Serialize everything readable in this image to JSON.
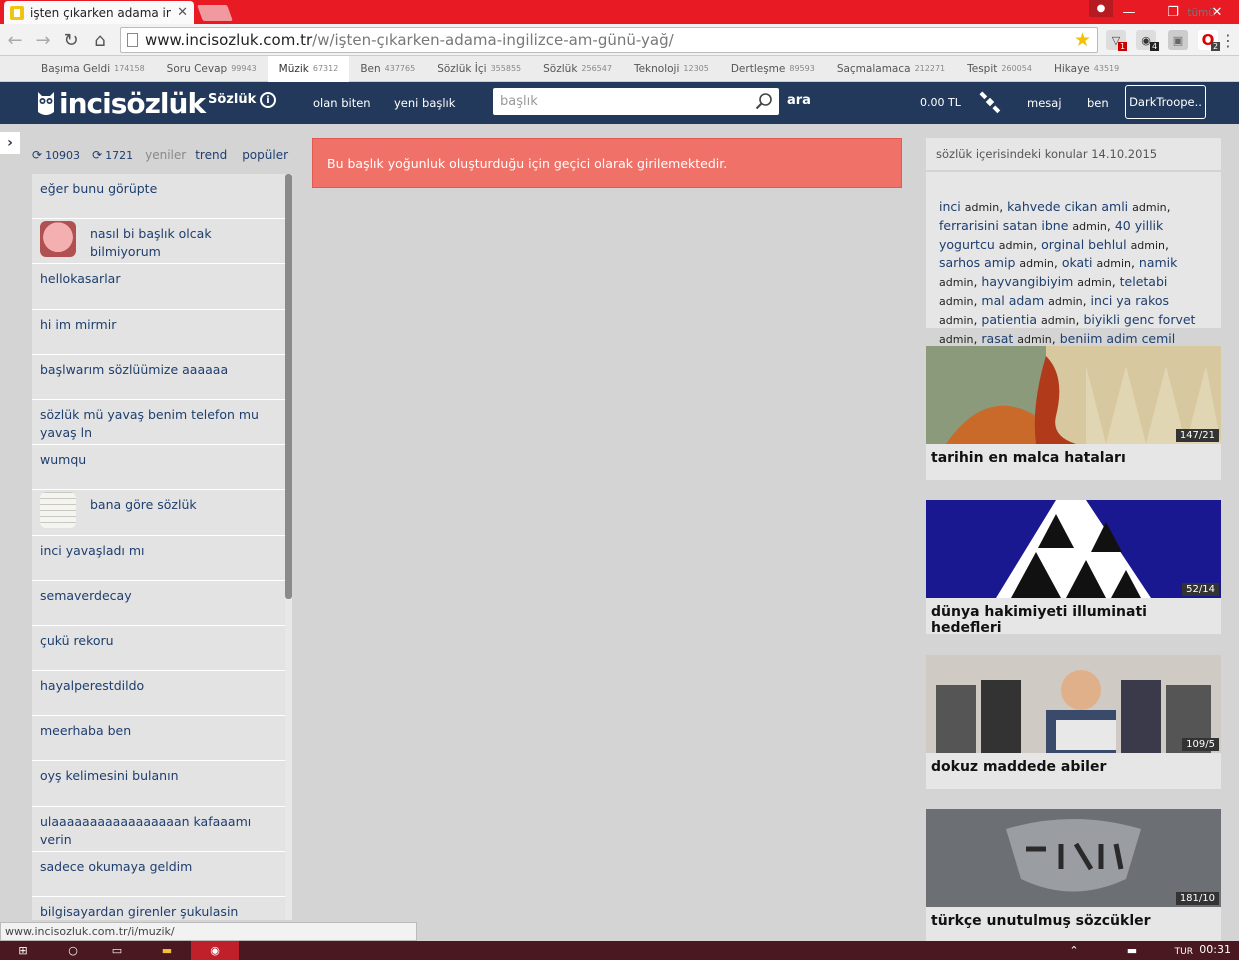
{
  "browser": {
    "tab_title": "işten çıkarken adama ingil",
    "close": "✕",
    "url_host": "www.incisozluk.com.tr",
    "url_path": "/w/işten-çıkarken-adama-ingilizce-am-günü-yağ/",
    "ext_badges": [
      "1",
      "4",
      "2"
    ],
    "window_controls": [
      "—",
      "❐",
      "✕"
    ]
  },
  "categories": [
    {
      "name": "Başıma Geldi",
      "count": "174158"
    },
    {
      "name": "Soru Cevap",
      "count": "99943"
    },
    {
      "name": "Müzik",
      "count": "67312"
    },
    {
      "name": "Ben",
      "count": "437765"
    },
    {
      "name": "Sözlük İçi",
      "count": "355855"
    },
    {
      "name": "Sözlük",
      "count": "256547"
    },
    {
      "name": "Teknoloji",
      "count": "12305"
    },
    {
      "name": "Dertleşme",
      "count": "89593"
    },
    {
      "name": "Saçmalamaca",
      "count": "212271"
    },
    {
      "name": "Tespit",
      "count": "260054"
    },
    {
      "name": "Hikaye",
      "count": "43519"
    }
  ],
  "categories_all": "tümü",
  "header": {
    "logo": "incisözlük",
    "section": "Sözlük",
    "nav_olan_biten": "olan biten",
    "nav_yeni_baslik": "yeni başlık",
    "search_placeholder": "başlık",
    "search_button": "ara",
    "balance": "0.00 TL",
    "nav_mesaj": "mesaj",
    "nav_ben": "ben",
    "user": "DarkTroope.."
  },
  "left": {
    "count1": "10903",
    "count2": "1721",
    "tab_yeniler": "yeniler",
    "tab_trend": "trend",
    "tab_populer": "popüler",
    "items": [
      "eğer bunu görüpte",
      "nasıl bi başlık olcak bilmiyorum",
      "hellokasarlar",
      "hi im mirmir",
      "başlwarım sözlüümize aaaaaa",
      "sözlük mü yavaş benim telefon mu yavaş ln",
      "wumqu",
      "bana göre sözlük",
      "inci yavaşladı mı",
      "semaverdecay",
      "çukü rekoru",
      "hayalperestdildo",
      "meerhaba ben",
      "oyş kelimesini bulanın",
      "ulaaaaaaaaaaaaaaaaan kafaaamı verin",
      "sadece okumaya geldim",
      "bilgisayardan girenler şukulasin"
    ]
  },
  "alert": "Bu başlık yoğunluk oluşturduğu için geçici olarak girilemektedir.",
  "right": {
    "head": "sözlük içerisindeki konular 14.10.2015",
    "admin": "admin",
    "topics": [
      "inci",
      "kahvede cikan amli",
      "ferrarisini satan ibne",
      "40 yillik yogurtcu",
      "orginal behlul",
      "sarhos amip",
      "okati",
      "namik",
      "hayvangibiyim",
      "teletabi",
      "mal adam",
      "inci ya rakos",
      "patientia",
      "biyikli genc forvet",
      "rasat",
      "beniim adim cemil"
    ],
    "cards": [
      {
        "title": "tarihin en malca hataları",
        "badge": "147/21"
      },
      {
        "title": "dünya hakimiyeti illuminati hedefleri",
        "badge": "52/14"
      },
      {
        "title": "dokuz maddede abiler",
        "badge": "109/5"
      },
      {
        "title": "türkçe unutulmuş sözcükler",
        "badge": "181/10"
      }
    ]
  },
  "status_url": "www.incisozluk.com.tr/i/muzik/",
  "taskbar": {
    "lang": "TUR",
    "time": "00:31"
  }
}
